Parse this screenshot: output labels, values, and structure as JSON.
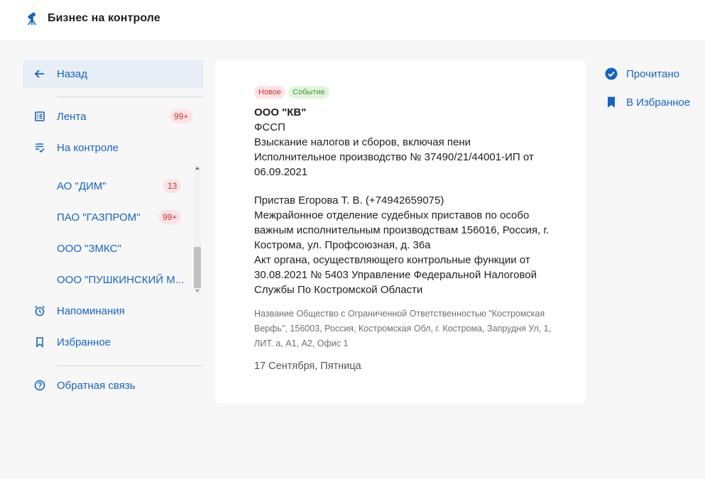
{
  "app": {
    "title": "Бизнес на контроле",
    "logo_icon": "telescope-icon",
    "accent_color": "#1565c0"
  },
  "sidebar": {
    "back_label": "Назад",
    "feed": {
      "label": "Лента",
      "badge": "99+"
    },
    "monitored": {
      "label": "На контроле"
    },
    "companies": [
      {
        "label": "АО \"ДИМ\"",
        "badge": "13"
      },
      {
        "label": "ПАО \"ГАЗПРОМ\"",
        "badge": "99+"
      },
      {
        "label": "ООО \"ЗМКС\"",
        "badge": ""
      },
      {
        "label": "ООО \"ПУШКИНСКИЙ М...",
        "badge": ""
      }
    ],
    "reminders_label": "Напоминания",
    "favorites_label": "Избранное",
    "feedback_label": "Обратная связь"
  },
  "card": {
    "tags": {
      "new": "Новое",
      "event": "Событие"
    },
    "company": "ООО \"КВ\"",
    "source": "ФССП",
    "subject": "Взыскание налогов и сборов, включая пени",
    "proceeding": "Исполнительное производство № 37490/21/44001-ИП от 06.09.2021",
    "bailiff": "Пристав Егорова Т. В. (+74942659075)",
    "department": "Межрайонное отделение судебных приставов по особо важным исполнительным производствам 156016, Россия, г. Кострома, ул. Профсоюзная, д. 36а",
    "act": "Акт органа, осуществляющего контрольные функции от 30.08.2021 № 5403 Управление Федеральной Налоговой Службы По Костромской Области",
    "debtor": "Название Общество с Ограниченной Ответственностью \"Костромская Верфь\", 156003, Россия, Костромская Обл, г. Кострома, Запрудня Ул, 1, ЛИТ. а, А1, А2, Офис 1",
    "date": "17 Сентября, Пятница"
  },
  "actions": {
    "read_label": "Прочитано",
    "favorite_label": "В Избранное"
  }
}
